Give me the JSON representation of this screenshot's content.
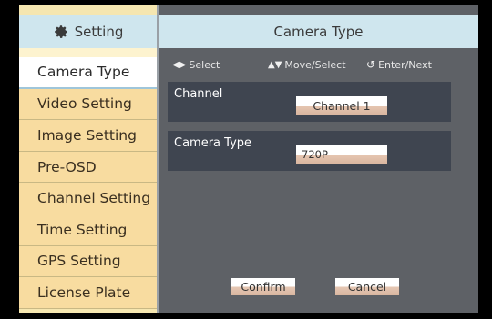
{
  "sidebar": {
    "title": "Setting",
    "items": [
      {
        "label": "Camera Type",
        "active": true
      },
      {
        "label": "Video Setting"
      },
      {
        "label": "Image Setting"
      },
      {
        "label": "Pre-OSD"
      },
      {
        "label": "Channel Setting"
      },
      {
        "label": "Time Setting"
      },
      {
        "label": "GPS Setting"
      },
      {
        "label": "License Plate"
      }
    ]
  },
  "panel": {
    "title": "Camera Type",
    "hints": {
      "select": "Select",
      "move_select": "Move/Select",
      "enter_next": "Enter/Next"
    },
    "fields": {
      "channel_label": "Channel",
      "channel_value": "Channel 1",
      "camera_type_label": "Camera Type",
      "camera_type_value": "720P"
    },
    "buttons": {
      "confirm": "Confirm",
      "cancel": "Cancel"
    }
  },
  "colors": {
    "header_bg": "#cfe6ee",
    "menu_bg": "#f8dca0",
    "panel_bg": "#5e6166",
    "row_bg": "#3f4550"
  },
  "icons": {
    "sidebar_header": "gear-icon",
    "hint_select": "left-right-arrow-icon",
    "hint_move": "up-down-arrow-icon",
    "hint_enter": "enter-return-icon"
  }
}
